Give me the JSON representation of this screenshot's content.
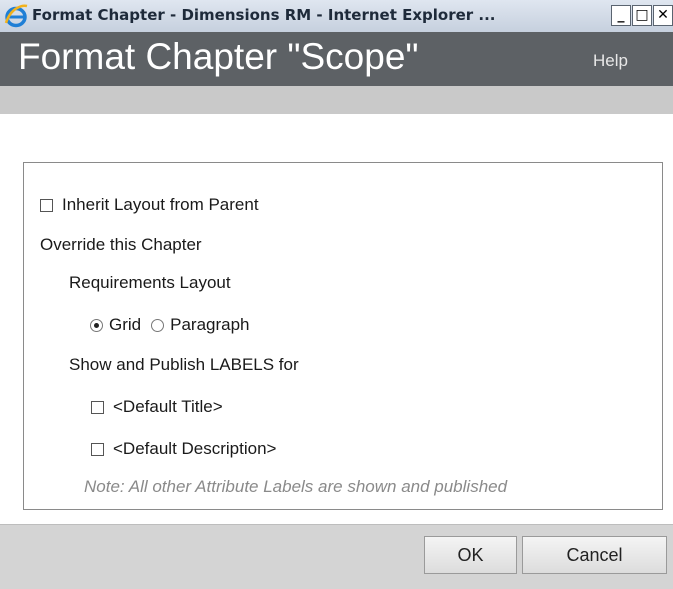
{
  "window": {
    "title": "Format Chapter - Dimensions RM - Internet Explorer ...",
    "controls": {
      "minimize": "_",
      "maximize": "□",
      "close": "✕"
    },
    "browser_icon": "ie-icon"
  },
  "header": {
    "title": "Format Chapter \"Scope\"",
    "help_label": "Help"
  },
  "form": {
    "inherit_label": "Inherit Layout from Parent",
    "inherit_checked": false,
    "override_heading": "Override this Chapter",
    "layout_heading": "Requirements Layout",
    "layout_options": [
      {
        "label": "Grid",
        "selected": true
      },
      {
        "label": "Paragraph",
        "selected": false
      }
    ],
    "labels_heading": "Show and Publish LABELS for",
    "label_options": [
      {
        "label": "<Default Title>",
        "checked": false
      },
      {
        "label": "<Default Description>",
        "checked": false
      }
    ],
    "note": "Note: All other Attribute Labels are shown and published"
  },
  "footer": {
    "ok_label": "OK",
    "cancel_label": "Cancel"
  },
  "colors": {
    "header_bg": "#5d6165",
    "strip_bg": "#c9c9c9",
    "footer_bg": "#d4d4d4",
    "note_text": "#8a8a8a"
  }
}
